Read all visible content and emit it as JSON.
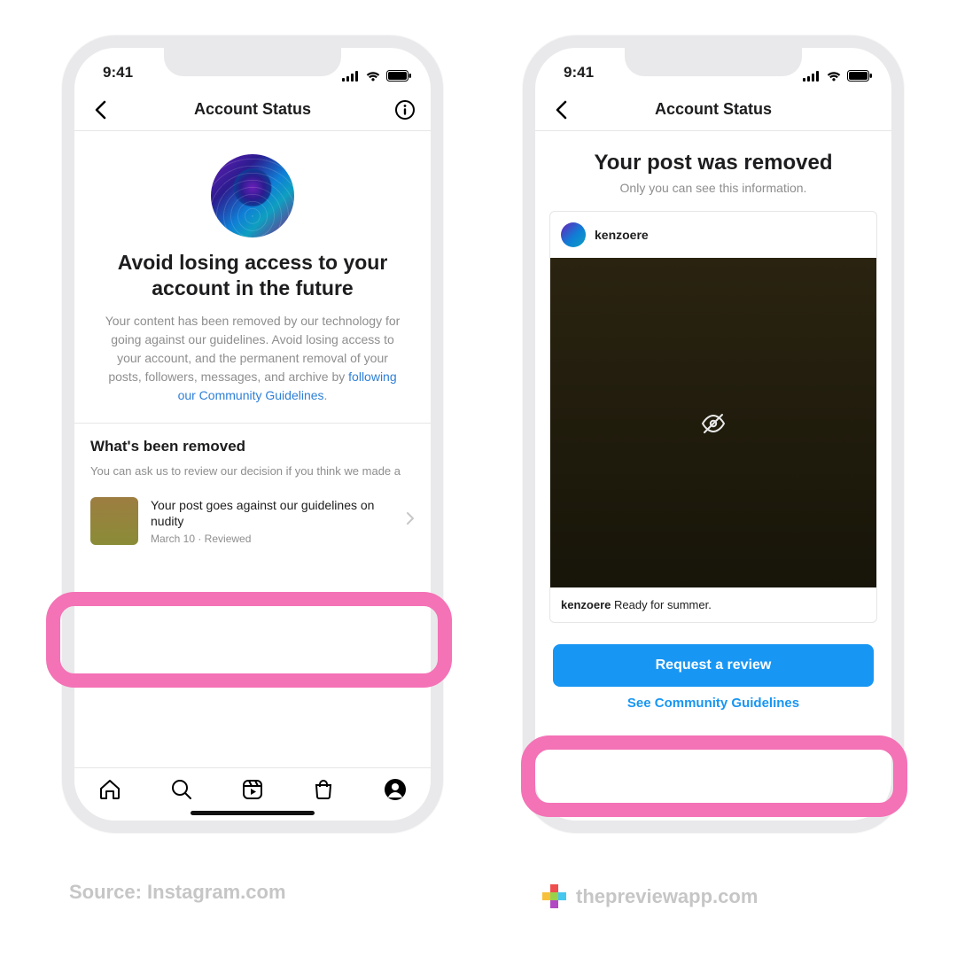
{
  "status_time": "9:41",
  "left": {
    "header_title": "Account Status",
    "h1": "Avoid losing access to your account in the future",
    "para_before": "Your content has been removed by our technology for going against our guidelines. Avoid losing access to your account, and the permanent removal of your posts, followers, messages, and archive by ",
    "para_link": "following our Community Guidelines",
    "para_after": ".",
    "section_h": "What's been removed",
    "section_p": "You can ask us to review our decision if you think we made a",
    "item_title": "Your post goes against our guidelines on nudity",
    "item_meta": "March 10 · Reviewed"
  },
  "right": {
    "header_title": "Account Status",
    "h1": "Your post was removed",
    "sub": "Only you can see this information.",
    "username": "kenzoere",
    "caption_user": "kenzoere",
    "caption_text": " Ready for summer.",
    "button": "Request a review",
    "link": "See Community Guidelines"
  },
  "footer": {
    "source": "Source: Instagram.com",
    "credit": "thepreviewapp.com"
  }
}
